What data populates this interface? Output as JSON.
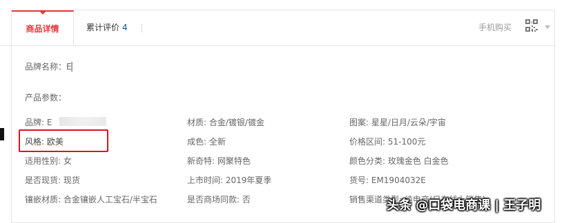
{
  "tabs": {
    "active_label": "商品详情",
    "reviews_label": "累计评价",
    "reviews_count": "4",
    "mobile_buy_label": "手机购买"
  },
  "brand_name": "品牌名称：E▏",
  "params_title": "产品参数：",
  "params": {
    "col1": [
      "品牌: E",
      "风格: 欧美",
      "适用性别: 女",
      "是否现货: 现货",
      "镶嵌材质: 合金镶嵌人工宝石/半宝石"
    ],
    "col2": [
      "材质: 合金/镀银/镀金",
      "成色: 全新",
      "新奇特: 网聚特色",
      "上市时间: 2019年夏季",
      "是否商场同款: 否"
    ],
    "col3": [
      "图案: 星星/日月/云朵/宇宙",
      "价格区间: 51-100元",
      "颜色分类: 玫瑰金色 白金色",
      "货号: EM1904032E",
      "销售渠道类型: 纯电商(只在线上销售)"
    ]
  },
  "watermark": "头条 @口袋电商课 | 王子明",
  "colors": {
    "accent": "#e4393c",
    "link": "#005aa0",
    "highlight": "#d9141d"
  },
  "icons": {
    "qr": "qr-code-icon",
    "dropdown": "chevron-down-icon"
  }
}
